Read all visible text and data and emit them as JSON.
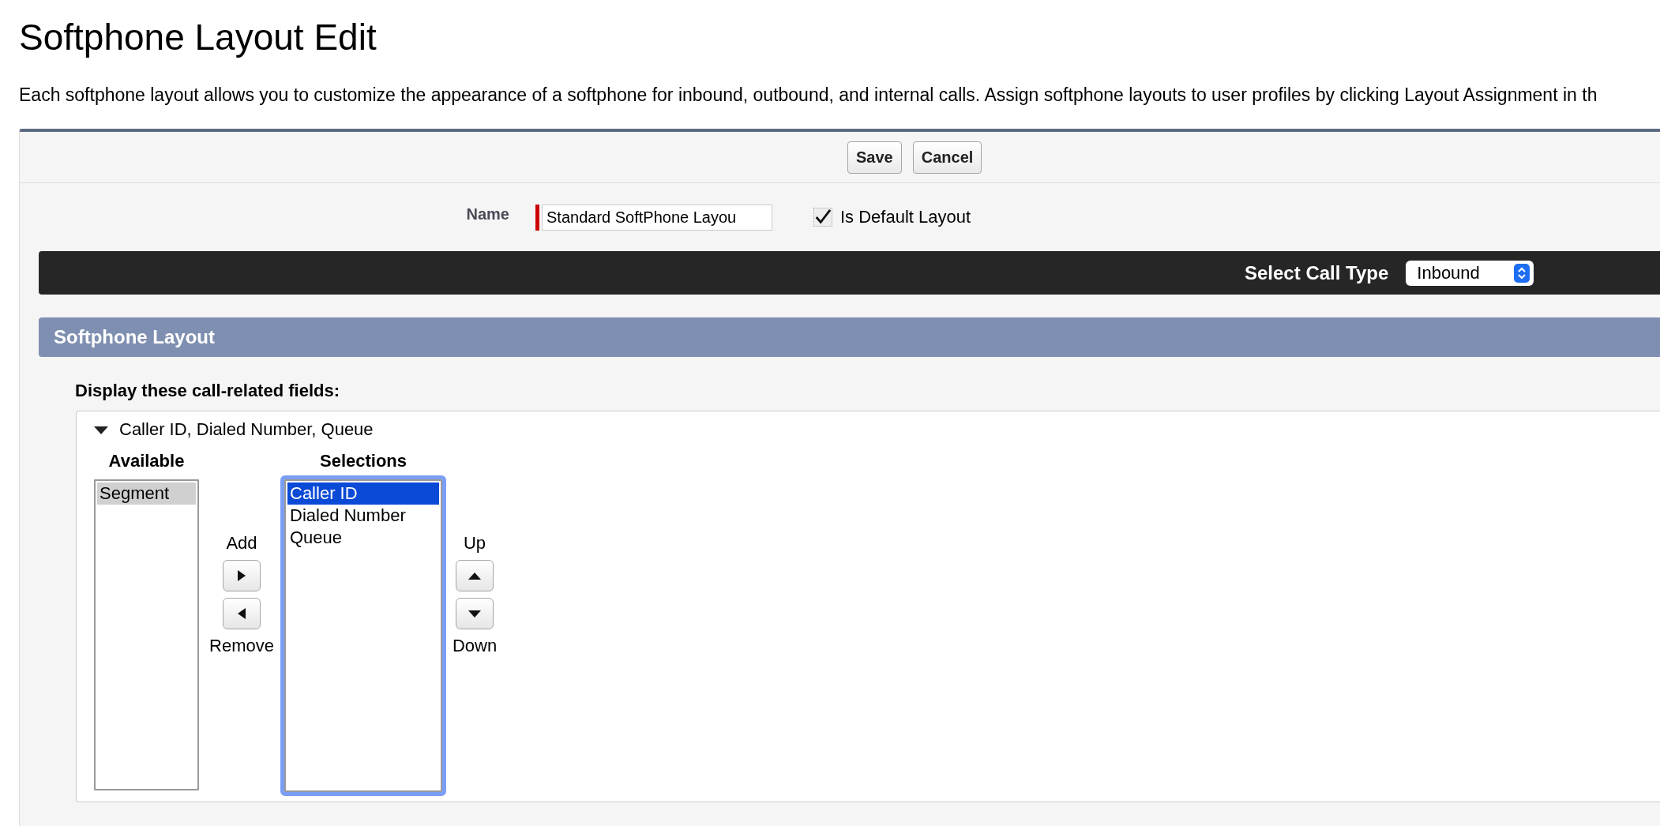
{
  "page": {
    "title": "Softphone Layout Edit",
    "description": "Each softphone layout allows you to customize the appearance of a softphone for inbound, outbound, and internal calls. Assign softphone layouts to user profiles by clicking Layout Assignment in th"
  },
  "button_bar": {
    "buttons": [
      "Save",
      "Cancel"
    ]
  },
  "name_field": {
    "label": "Name",
    "value": "Standard SoftPhone Layou",
    "required": true
  },
  "default_layout": {
    "label": "Is Default Layout",
    "checked": true
  },
  "call_type": {
    "label": "Select Call Type",
    "value": "Inbound"
  },
  "section": {
    "title": "Softphone Layout"
  },
  "fields": {
    "label": "Display these call-related fields:",
    "group": {
      "title": "Caller ID, Dialed Number, Queue",
      "expanded": true,
      "available": {
        "label": "Available",
        "focused": false,
        "items": [
          {
            "text": "Segment",
            "selected": true
          }
        ]
      },
      "transfer_controls": [
        {
          "label": "Add",
          "kind": "right"
        },
        {
          "label": "Remove",
          "kind": "left"
        }
      ],
      "selections": {
        "label": "Selections",
        "focused": true,
        "items": [
          {
            "text": "Caller ID",
            "selected": true
          },
          {
            "text": "Dialed Number",
            "selected": false
          },
          {
            "text": "Queue",
            "selected": false
          }
        ]
      },
      "order_controls": [
        {
          "label": "Up",
          "kind": "up"
        },
        {
          "label": "Down",
          "kind": "down"
        }
      ]
    }
  }
}
